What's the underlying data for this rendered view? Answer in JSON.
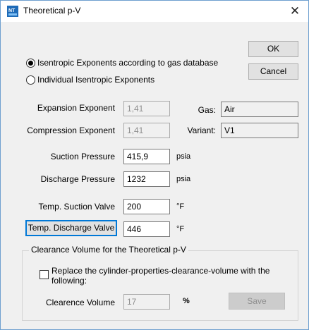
{
  "window": {
    "title": "Theoretical p-V",
    "icon_name": "app-icon",
    "close_symbol": "✕"
  },
  "options": {
    "radio_gas_db": {
      "label": "Isentropic Exponents according to gas database",
      "selected": true
    },
    "radio_individual": {
      "label": "Individual Isentropic Exponents",
      "selected": false
    }
  },
  "buttons": {
    "ok": "OK",
    "cancel": "Cancel",
    "save": "Save"
  },
  "exponents": {
    "expansion_label": "Expansion Exponent",
    "expansion_value": "1,41",
    "compression_label": "Compression Exponent",
    "compression_value": "1,41"
  },
  "gas": {
    "gas_label": "Gas:",
    "gas_value": "Air",
    "variant_label": "Variant:",
    "variant_value": "V1"
  },
  "pressure": {
    "suction_label": "Suction Pressure",
    "suction_value": "415,9",
    "suction_unit": "psia",
    "discharge_label": "Discharge Pressure",
    "discharge_value": "1232",
    "discharge_unit": "psia"
  },
  "temperature": {
    "suction_label": "Temp. Suction Valve",
    "suction_value": "200",
    "suction_unit": "°F",
    "discharge_label": "Temp. Discharge Valve",
    "discharge_value": "446",
    "discharge_unit": "°F"
  },
  "clearance": {
    "group_title": "Clearance Volume for the Theoretical p-V",
    "checkbox_label_line1": "Replace the cylinder-properties-clearance-volume with the",
    "checkbox_label_line2": "following:",
    "checkbox_checked": false,
    "volume_label": "Clearence Volume",
    "volume_value": "17",
    "volume_unit": "%"
  },
  "colors": {
    "accent": "#0078d7",
    "window_bg": "#f0f0f0",
    "icon_bg": "#1e6bb8"
  }
}
